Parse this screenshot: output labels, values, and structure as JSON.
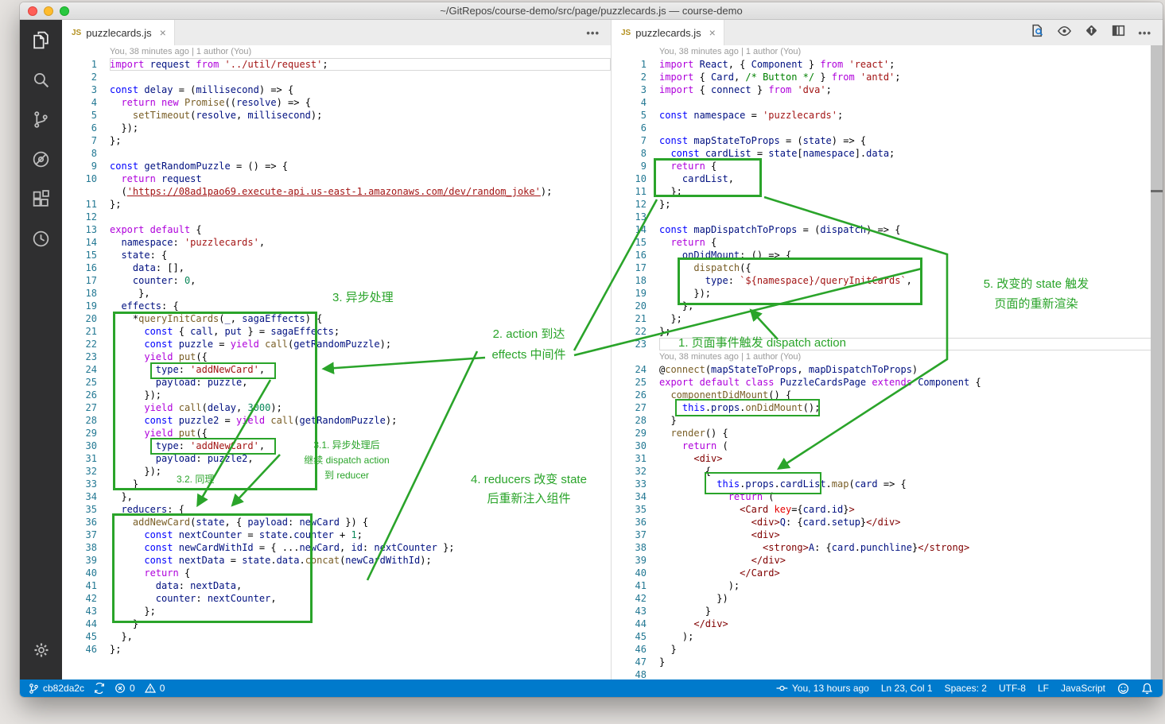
{
  "window": {
    "title": "~/GitRepos/course-demo/src/page/puzzlecards.js — course-demo"
  },
  "colors": {
    "annotation": "#2aa42a",
    "statusbar": "#007acc"
  },
  "activity_bar": {
    "items": [
      "explorer-icon",
      "search-icon",
      "source-control-icon",
      "debug-icon",
      "extensions-icon",
      "gitlens-icon"
    ],
    "bottom": [
      "settings-gear-icon"
    ]
  },
  "tabs": {
    "left": {
      "label": "puzzlecards.js",
      "icon": "js-file-icon"
    },
    "right": {
      "label": "puzzlecards.js",
      "icon": "js-file-icon"
    }
  },
  "editor_actions": [
    "open-changes-icon",
    "toggle-blame-icon",
    "git-diamond-icon",
    "split-editor-icon",
    "more-actions-icon"
  ],
  "codelens": "You, 38 minutes ago | 1 author (You)",
  "left_editor": {
    "lines": [
      {
        "t": "lens"
      },
      {
        "n": 1,
        "c": "import request from '../util/request';",
        "cur": true
      },
      {
        "n": 2,
        "c": ""
      },
      {
        "n": 3,
        "c": "const delay = (millisecond) => {"
      },
      {
        "n": 4,
        "c": "  return new Promise((resolve) => {"
      },
      {
        "n": 5,
        "c": "    setTimeout(resolve, millisecond);"
      },
      {
        "n": 6,
        "c": "  });"
      },
      {
        "n": 7,
        "c": "};"
      },
      {
        "n": 8,
        "c": ""
      },
      {
        "n": 9,
        "c": "const getRandomPuzzle = () => {"
      },
      {
        "n": 10,
        "c": "  return request"
      },
      {
        "t": "wrap",
        "c": "  ('https://08ad1pao69.execute-api.us-east-1.amazonaws.com/dev/random_joke');"
      },
      {
        "n": 11,
        "c": "};"
      },
      {
        "n": 12,
        "c": ""
      },
      {
        "n": 13,
        "c": "export default {"
      },
      {
        "n": 14,
        "c": "  namespace: 'puzzlecards',"
      },
      {
        "n": 15,
        "c": "  state: {"
      },
      {
        "n": 16,
        "c": "    data: [],"
      },
      {
        "n": 17,
        "c": "    counter: 0,"
      },
      {
        "n": 18,
        "c": "     },"
      },
      {
        "n": 19,
        "c": "  effects: {"
      },
      {
        "n": 20,
        "c": "    *queryInitCards(_, sagaEffects) {"
      },
      {
        "n": 21,
        "c": "      const { call, put } = sagaEffects;"
      },
      {
        "n": 22,
        "c": "      const puzzle = yield call(getRandomPuzzle);"
      },
      {
        "n": 23,
        "c": "      yield put({"
      },
      {
        "n": 24,
        "c": "        type: 'addNewCard',"
      },
      {
        "n": 25,
        "c": "        payload: puzzle,"
      },
      {
        "n": 26,
        "c": "      });"
      },
      {
        "n": 27,
        "c": "      yield call(delay, 3000);"
      },
      {
        "n": 28,
        "c": "      const puzzle2 = yield call(getRandomPuzzle);"
      },
      {
        "n": 29,
        "c": "      yield put({"
      },
      {
        "n": 30,
        "c": "        type: 'addNewCard',"
      },
      {
        "n": 31,
        "c": "        payload: puzzle2,"
      },
      {
        "n": 32,
        "c": "      });"
      },
      {
        "n": 33,
        "c": "    }"
      },
      {
        "n": 34,
        "c": "  },"
      },
      {
        "n": 35,
        "c": "  reducers: {"
      },
      {
        "n": 36,
        "c": "    addNewCard(state, { payload: newCard }) {"
      },
      {
        "n": 37,
        "c": "      const nextCounter = state.counter + 1;"
      },
      {
        "n": 38,
        "c": "      const newCardWithId = { ...newCard, id: nextCounter };"
      },
      {
        "n": 39,
        "c": "      const nextData = state.data.concat(newCardWithId);"
      },
      {
        "n": 40,
        "c": "      return {"
      },
      {
        "n": 41,
        "c": "        data: nextData,"
      },
      {
        "n": 42,
        "c": "        counter: nextCounter,"
      },
      {
        "n": 43,
        "c": "      };"
      },
      {
        "n": 44,
        "c": "    }"
      },
      {
        "n": 45,
        "c": "  },"
      },
      {
        "n": 46,
        "c": "};"
      }
    ]
  },
  "right_editor": {
    "lines": [
      {
        "t": "lens"
      },
      {
        "n": 1,
        "c": "import React, { Component } from 'react';"
      },
      {
        "n": 2,
        "c": "import { Card, /* Button */ } from 'antd';"
      },
      {
        "n": 3,
        "c": "import { connect } from 'dva';"
      },
      {
        "n": 4,
        "c": ""
      },
      {
        "n": 5,
        "c": "const namespace = 'puzzlecards';"
      },
      {
        "n": 6,
        "c": ""
      },
      {
        "n": 7,
        "c": "const mapStateToProps = (state) => {"
      },
      {
        "n": 8,
        "c": "  const cardList = state[namespace].data;"
      },
      {
        "n": 9,
        "c": "  return {"
      },
      {
        "n": 10,
        "c": "    cardList,"
      },
      {
        "n": 11,
        "c": "  };"
      },
      {
        "n": 12,
        "c": "};"
      },
      {
        "n": 13,
        "c": ""
      },
      {
        "n": 14,
        "c": "const mapDispatchToProps = (dispatch) => {"
      },
      {
        "n": 15,
        "c": "  return {"
      },
      {
        "n": 16,
        "c": "    onDidMount: () => {"
      },
      {
        "n": 17,
        "c": "      dispatch({"
      },
      {
        "n": 18,
        "c": "        type: `${namespace}/queryInitCards`,"
      },
      {
        "n": 19,
        "c": "      });"
      },
      {
        "n": 20,
        "c": "    },"
      },
      {
        "n": 21,
        "c": "  };"
      },
      {
        "n": 22,
        "c": "};"
      },
      {
        "n": 23,
        "c": "",
        "cur": true
      },
      {
        "t": "lens"
      },
      {
        "n": 24,
        "c": "@connect(mapStateToProps, mapDispatchToProps)"
      },
      {
        "n": 25,
        "c": "export default class PuzzleCardsPage extends Component {"
      },
      {
        "n": 26,
        "c": "  componentDidMount() {"
      },
      {
        "n": 27,
        "c": "    this.props.onDidMount();"
      },
      {
        "n": 28,
        "c": "  }"
      },
      {
        "n": 29,
        "c": "  render() {"
      },
      {
        "n": 30,
        "c": "    return ("
      },
      {
        "n": 31,
        "c": "      <div>"
      },
      {
        "n": 32,
        "c": "        {"
      },
      {
        "n": 33,
        "c": "          this.props.cardList.map(card => {"
      },
      {
        "n": 34,
        "c": "            return ("
      },
      {
        "n": 35,
        "c": "              <Card key={card.id}>"
      },
      {
        "n": 36,
        "c": "                <div>Q: {card.setup}</div>"
      },
      {
        "n": 37,
        "c": "                <div>"
      },
      {
        "n": 38,
        "c": "                  <strong>A: {card.punchline}</strong>"
      },
      {
        "n": 39,
        "c": "                </div>"
      },
      {
        "n": 40,
        "c": "              </Card>"
      },
      {
        "n": 41,
        "c": "            );"
      },
      {
        "n": 42,
        "c": "          })"
      },
      {
        "n": 43,
        "c": "        }"
      },
      {
        "n": 44,
        "c": "      </div>"
      },
      {
        "n": 45,
        "c": "    );"
      },
      {
        "n": 46,
        "c": "  }"
      },
      {
        "n": 47,
        "c": "}"
      },
      {
        "n": 48,
        "c": ""
      }
    ]
  },
  "annotations": {
    "labels": {
      "l1": "1. 页面事件触发 dispatch action",
      "l2a": "2. action 到达",
      "l2b": "effects 中间件",
      "l3": "3. 异步处理",
      "l31a": "3.1. 异步处理后",
      "l31b": "继续 dispatch action",
      "l31c": "到 reducer",
      "l32": "3.2. 同理",
      "l4a": "4. reducers 改变 state",
      "l4b": "后重新注入组件",
      "l5a": "5. 改变的 state 触发",
      "l5b": "页面的重新渲染"
    }
  },
  "status_bar": {
    "branch": "cb82da2c",
    "errors": "0",
    "warnings": "0",
    "blame": "You, 13 hours ago",
    "cursor": "Ln 23, Col 1",
    "indent": "Spaces: 2",
    "encoding": "UTF-8",
    "eol": "LF",
    "language": "JavaScript"
  }
}
